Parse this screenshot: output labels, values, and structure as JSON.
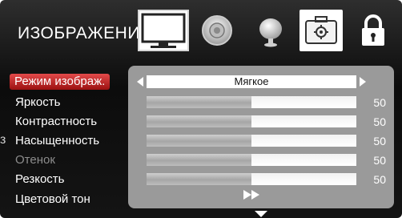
{
  "menu": {
    "title": "ИЗОБРАЖЕНИЕ",
    "categories": [
      {
        "name": "picture",
        "icon": "tv-icon",
        "active": true
      },
      {
        "name": "sound",
        "icon": "speaker-icon"
      },
      {
        "name": "channel",
        "icon": "satellite-dish-icon"
      },
      {
        "name": "setup",
        "icon": "toolbox-gear-icon"
      },
      {
        "name": "lock",
        "icon": "padlock-icon"
      }
    ]
  },
  "settings": {
    "mode": {
      "label": "Режим изображ.",
      "value": "Мягкое"
    },
    "brightness": {
      "label": "Яркость",
      "value": "50",
      "level": 50
    },
    "contrast": {
      "label": "Контрастность",
      "value": "50",
      "level": 50
    },
    "saturation": {
      "label": "Насыщенность",
      "value": "50",
      "level": 50
    },
    "hue": {
      "label": "Отенок",
      "value": "50",
      "level": 50,
      "disabled": true
    },
    "sharpness": {
      "label": "Резкость",
      "value": "50",
      "level": 50
    },
    "color_tone": {
      "label": "Цветовой тон",
      "more": "»"
    }
  },
  "side_mark": "з",
  "colors": {
    "selection": "#c62828",
    "panel": "#9a9a9a",
    "background": "#141414"
  }
}
